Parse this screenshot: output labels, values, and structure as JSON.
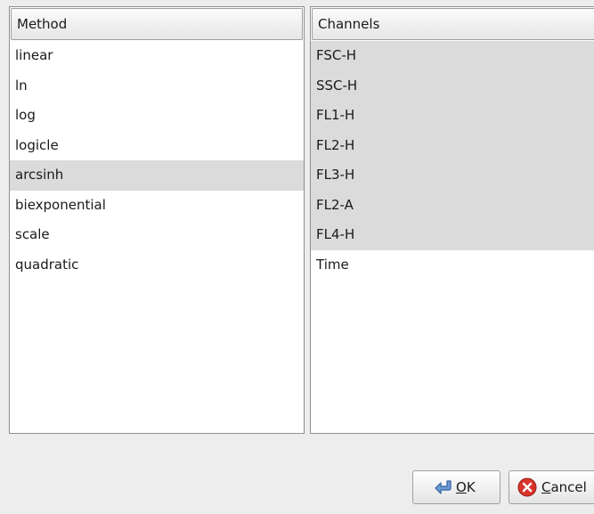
{
  "methods": {
    "header": "Method",
    "items": [
      "linear",
      "ln",
      "log",
      "logicle",
      "arcsinh",
      "biexponential",
      "scale",
      "quadratic"
    ],
    "selected_index": 4
  },
  "channels": {
    "header": "Channels",
    "items": [
      "FSC-H",
      "SSC-H",
      "FL1-H",
      "FL2-H",
      "FL3-H",
      "FL2-A",
      "FL4-H",
      "Time"
    ],
    "selected": [
      "FSC-H",
      "SSC-H",
      "FL1-H",
      "FL2-H",
      "FL3-H",
      "FL2-A",
      "FL4-H"
    ]
  },
  "buttons": {
    "ok_label": "OK",
    "ok_icon": "arrow-return-icon",
    "cancel_label": "Cancel",
    "cancel_icon": "cancel-x-icon"
  },
  "colors": {
    "selection": "#dbdbdb",
    "window_bg": "#ededed",
    "cancel_red": "#d9342b",
    "ok_blue": "#4a7fc1"
  }
}
